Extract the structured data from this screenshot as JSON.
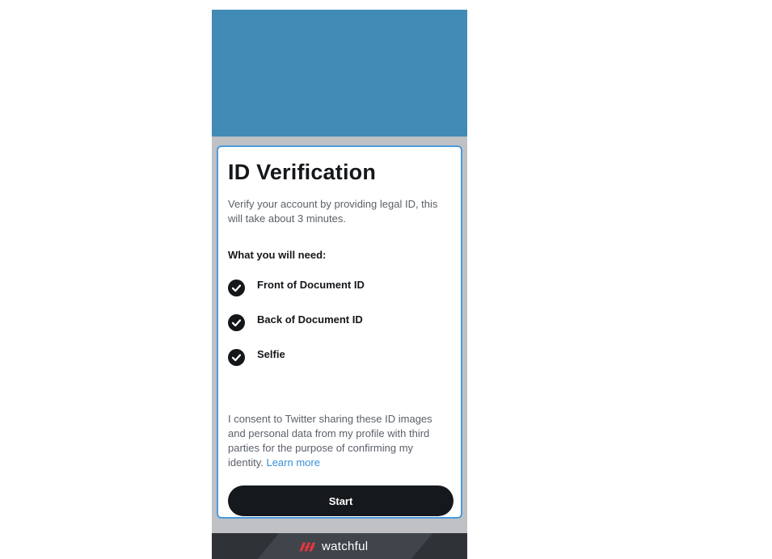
{
  "verification": {
    "title": "ID Verification",
    "subtitle": "Verify your account by providing legal ID, this will take about 3 minutes.",
    "need_heading": "What you will need:",
    "requirements": [
      {
        "label": "Front of Document ID",
        "icon": "check-circle-icon"
      },
      {
        "label": "Back of Document ID",
        "icon": "check-circle-icon"
      },
      {
        "label": "Selfie",
        "icon": "check-circle-icon"
      }
    ],
    "consent_text": "I consent to Twitter sharing these ID images and personal data from my profile with third parties for the purpose of confirming my identity.",
    "learn_more": "Learn more",
    "start_label": "Start"
  },
  "footer": {
    "brand": "watchful",
    "logo_icon": "watchful-logo-icon",
    "logo_color": "#e8363e"
  },
  "colors": {
    "hero": "#418bb6",
    "accent_link": "#3a8fd4",
    "card_border": "#4b9be0",
    "button": "#15181c"
  }
}
